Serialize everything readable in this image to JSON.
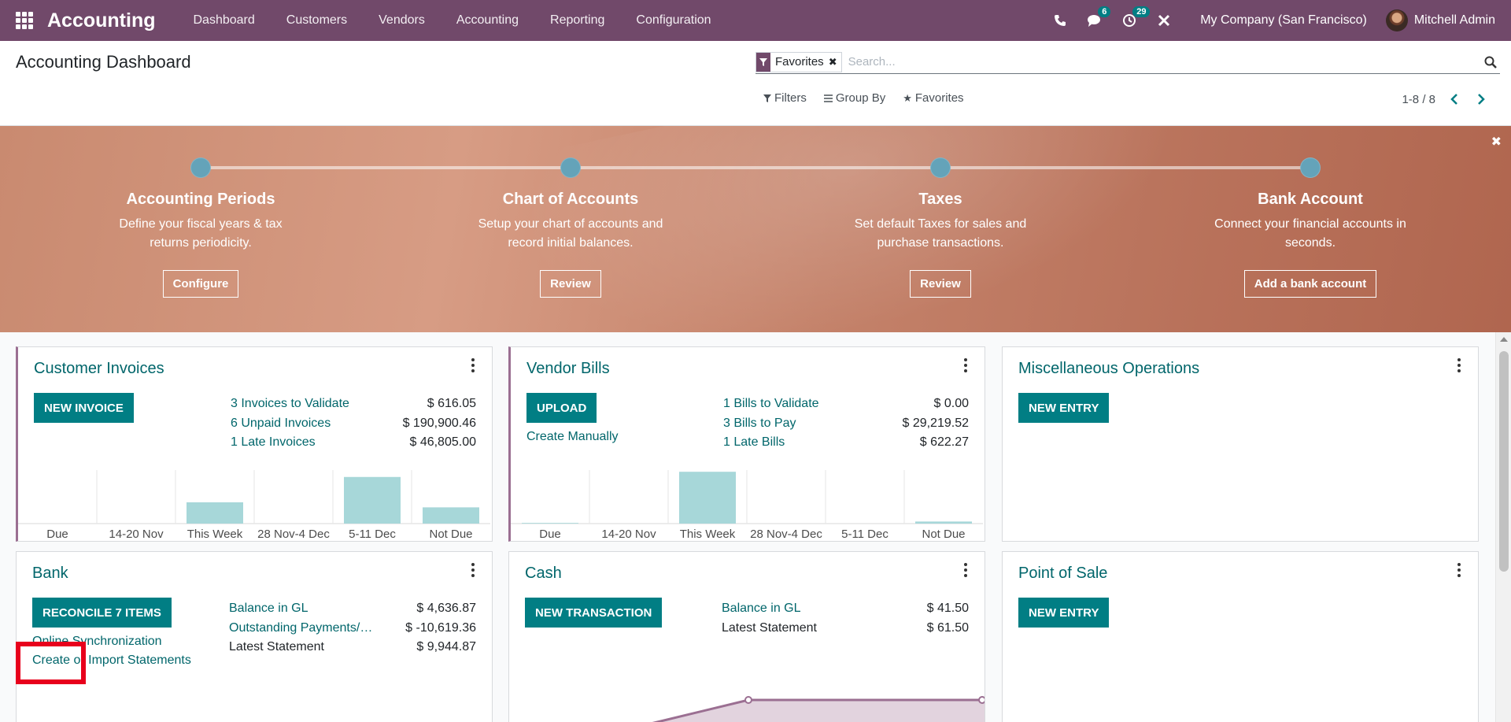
{
  "navbar": {
    "brand": "Accounting",
    "menu": [
      "Dashboard",
      "Customers",
      "Vendors",
      "Accounting",
      "Reporting",
      "Configuration"
    ],
    "messages_count": "6",
    "activities_count": "29",
    "company": "My Company (San Francisco)",
    "user": "Mitchell Admin",
    "bg_color": "#71496a"
  },
  "control": {
    "title": "Accounting Dashboard",
    "facet_label": "Favorites",
    "search_placeholder": "Search...",
    "filters": "Filters",
    "group_by": "Group By",
    "favorites": "Favorites",
    "pager": "1-8 / 8"
  },
  "onboarding": {
    "steps": [
      {
        "title": "Accounting Periods",
        "desc": "Define your fiscal years & tax returns periodicity.",
        "button": "Configure"
      },
      {
        "title": "Chart of Accounts",
        "desc": "Setup your chart of accounts and record initial balances.",
        "button": "Review"
      },
      {
        "title": "Taxes",
        "desc": "Set default Taxes for sales and purchase transactions.",
        "button": "Review"
      },
      {
        "title": "Bank Account",
        "desc": "Connect your financial accounts in seconds.",
        "button": "Add a bank account"
      }
    ]
  },
  "cards": {
    "customer_invoices": {
      "title": "Customer Invoices",
      "button": "NEW INVOICE",
      "stats": [
        {
          "label": "3 Invoices to Validate",
          "value": "$ 616.05"
        },
        {
          "label": "6 Unpaid Invoices",
          "value": "$ 190,900.46"
        },
        {
          "label": "1 Late Invoices",
          "value": "$ 46,805.00"
        }
      ]
    },
    "vendor_bills": {
      "title": "Vendor Bills",
      "button": "UPLOAD",
      "create_link": "Create Manually",
      "stats": [
        {
          "label": "1 Bills to Validate",
          "value": "$ 0.00"
        },
        {
          "label": "3 Bills to Pay",
          "value": "$ 29,219.52"
        },
        {
          "label": "1 Late Bills",
          "value": "$ 622.27"
        }
      ]
    },
    "misc": {
      "title": "Miscellaneous Operations",
      "button": "NEW ENTRY"
    },
    "bank": {
      "title": "Bank",
      "button": "RECONCILE 7 ITEMS",
      "link_sync": "Online Synchronization",
      "link_import": "Create or Import Statements",
      "stats": [
        {
          "label": "Balance in GL",
          "value": "$ 4,636.87"
        },
        {
          "label": "Outstanding Payments/Receipts",
          "value": "$ -10,619.36"
        },
        {
          "label": "Latest Statement",
          "value": "$ 9,944.87"
        }
      ]
    },
    "cash": {
      "title": "Cash",
      "button": "NEW TRANSACTION",
      "stats": [
        {
          "label": "Balance in GL",
          "value": "$ 41.50"
        },
        {
          "label": "Latest Statement",
          "value": "$ 61.50"
        }
      ]
    },
    "pos": {
      "title": "Point of Sale",
      "button": "NEW ENTRY"
    }
  },
  "chart_data": [
    {
      "type": "bar",
      "categories": [
        "Due",
        "14-20 Nov",
        "This Week",
        "28 Nov-4 Dec",
        "5-11 Dec",
        "Not Due"
      ],
      "values": [
        0,
        0,
        616,
        0,
        1350,
        470
      ],
      "ylim": [
        0,
        1550
      ],
      "grid": true
    },
    {
      "type": "bar",
      "categories": [
        "Due",
        "14-20 Nov",
        "This Week",
        "28 Nov-4 Dec",
        "5-11 Dec",
        "Not Due"
      ],
      "values": [
        20,
        0,
        1500,
        0,
        0,
        60
      ],
      "ylim": [
        0,
        1550
      ],
      "grid": true
    }
  ],
  "colors": {
    "primary": "#017e84",
    "link": "#01666b",
    "bar": "#a7d7d9",
    "line": "#9b6f92"
  }
}
